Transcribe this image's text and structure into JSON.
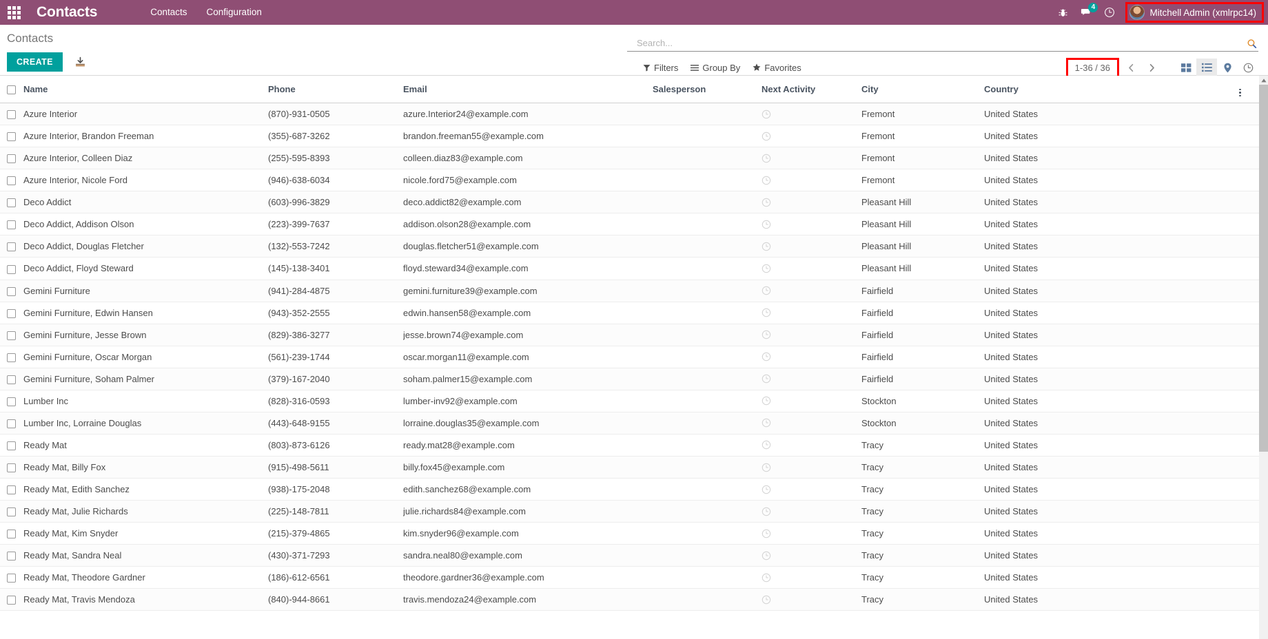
{
  "navbar": {
    "apps_menu_label": "Apps",
    "brand": "Contacts",
    "menus": [
      {
        "label": "Contacts"
      },
      {
        "label": "Configuration"
      }
    ],
    "icons": {
      "debug": "bug-icon",
      "messages": "messages-icon",
      "activities": "activities-clock-icon"
    },
    "message_count": "4",
    "user_name": "Mitchell Admin (xmlrpc14)",
    "highlight_color": "#ff0000",
    "background_color": "#8f4e74"
  },
  "control_panel": {
    "breadcrumb": "Contacts",
    "create_label": "CREATE",
    "create_color": "#00a09d",
    "import_icon": "import-icon",
    "search": {
      "placeholder": "Search...",
      "value": "",
      "icon": "search-icon"
    },
    "filters": [
      {
        "label": "Filters",
        "icon": "filter-icon"
      },
      {
        "label": "Group By",
        "icon": "group-by-icon"
      },
      {
        "label": "Favorites",
        "icon": "star-icon"
      }
    ],
    "pager": {
      "count": "1-36 / 36",
      "previous_icon": "chevron-left-icon",
      "next_icon": "chevron-right-icon",
      "highlight_color": "#ff0000"
    },
    "views": [
      {
        "name": "kanban",
        "icon": "kanban-icon",
        "active": false
      },
      {
        "name": "list",
        "icon": "list-icon",
        "active": true
      },
      {
        "name": "map",
        "icon": "map-pin-icon",
        "active": true
      },
      {
        "name": "activity",
        "icon": "activity-clock-icon",
        "active": false
      }
    ]
  },
  "table": {
    "columns": [
      "Name",
      "Phone",
      "Email",
      "Salesperson",
      "Next Activity",
      "City",
      "Country"
    ],
    "options_icon": "column-options-icon",
    "select_all_label": "Select all",
    "rows": [
      {
        "name": "Azure Interior",
        "phone": "(870)-931-0505",
        "email": "azure.Interior24@example.com",
        "salesperson": "",
        "activity": "",
        "city": "Fremont",
        "country": "United States"
      },
      {
        "name": "Azure Interior, Brandon Freeman",
        "phone": "(355)-687-3262",
        "email": "brandon.freeman55@example.com",
        "salesperson": "",
        "activity": "",
        "city": "Fremont",
        "country": "United States"
      },
      {
        "name": "Azure Interior, Colleen Diaz",
        "phone": "(255)-595-8393",
        "email": "colleen.diaz83@example.com",
        "salesperson": "",
        "activity": "",
        "city": "Fremont",
        "country": "United States"
      },
      {
        "name": "Azure Interior, Nicole Ford",
        "phone": "(946)-638-6034",
        "email": "nicole.ford75@example.com",
        "salesperson": "",
        "activity": "",
        "city": "Fremont",
        "country": "United States"
      },
      {
        "name": "Deco Addict",
        "phone": "(603)-996-3829",
        "email": "deco.addict82@example.com",
        "salesperson": "",
        "activity": "",
        "city": "Pleasant Hill",
        "country": "United States"
      },
      {
        "name": "Deco Addict, Addison Olson",
        "phone": "(223)-399-7637",
        "email": "addison.olson28@example.com",
        "salesperson": "",
        "activity": "",
        "city": "Pleasant Hill",
        "country": "United States"
      },
      {
        "name": "Deco Addict, Douglas Fletcher",
        "phone": "(132)-553-7242",
        "email": "douglas.fletcher51@example.com",
        "salesperson": "",
        "activity": "",
        "city": "Pleasant Hill",
        "country": "United States"
      },
      {
        "name": "Deco Addict, Floyd Steward",
        "phone": "(145)-138-3401",
        "email": "floyd.steward34@example.com",
        "salesperson": "",
        "activity": "",
        "city": "Pleasant Hill",
        "country": "United States"
      },
      {
        "name": "Gemini Furniture",
        "phone": "(941)-284-4875",
        "email": "gemini.furniture39@example.com",
        "salesperson": "",
        "activity": "",
        "city": "Fairfield",
        "country": "United States"
      },
      {
        "name": "Gemini Furniture, Edwin Hansen",
        "phone": "(943)-352-2555",
        "email": "edwin.hansen58@example.com",
        "salesperson": "",
        "activity": "",
        "city": "Fairfield",
        "country": "United States"
      },
      {
        "name": "Gemini Furniture, Jesse Brown",
        "phone": "(829)-386-3277",
        "email": "jesse.brown74@example.com",
        "salesperson": "",
        "activity": "",
        "city": "Fairfield",
        "country": "United States"
      },
      {
        "name": "Gemini Furniture, Oscar Morgan",
        "phone": "(561)-239-1744",
        "email": "oscar.morgan11@example.com",
        "salesperson": "",
        "activity": "",
        "city": "Fairfield",
        "country": "United States"
      },
      {
        "name": "Gemini Furniture, Soham Palmer",
        "phone": "(379)-167-2040",
        "email": "soham.palmer15@example.com",
        "salesperson": "",
        "activity": "",
        "city": "Fairfield",
        "country": "United States"
      },
      {
        "name": "Lumber Inc",
        "phone": "(828)-316-0593",
        "email": "lumber-inv92@example.com",
        "salesperson": "",
        "activity": "",
        "city": "Stockton",
        "country": "United States"
      },
      {
        "name": "Lumber Inc, Lorraine Douglas",
        "phone": "(443)-648-9155",
        "email": "lorraine.douglas35@example.com",
        "salesperson": "",
        "activity": "",
        "city": "Stockton",
        "country": "United States"
      },
      {
        "name": "Ready Mat",
        "phone": "(803)-873-6126",
        "email": "ready.mat28@example.com",
        "salesperson": "",
        "activity": "",
        "city": "Tracy",
        "country": "United States"
      },
      {
        "name": "Ready Mat, Billy Fox",
        "phone": "(915)-498-5611",
        "email": "billy.fox45@example.com",
        "salesperson": "",
        "activity": "",
        "city": "Tracy",
        "country": "United States"
      },
      {
        "name": "Ready Mat, Edith Sanchez",
        "phone": "(938)-175-2048",
        "email": "edith.sanchez68@example.com",
        "salesperson": "",
        "activity": "",
        "city": "Tracy",
        "country": "United States"
      },
      {
        "name": "Ready Mat, Julie Richards",
        "phone": "(225)-148-7811",
        "email": "julie.richards84@example.com",
        "salesperson": "",
        "activity": "",
        "city": "Tracy",
        "country": "United States"
      },
      {
        "name": "Ready Mat, Kim Snyder",
        "phone": "(215)-379-4865",
        "email": "kim.snyder96@example.com",
        "salesperson": "",
        "activity": "",
        "city": "Tracy",
        "country": "United States"
      },
      {
        "name": "Ready Mat, Sandra Neal",
        "phone": "(430)-371-7293",
        "email": "sandra.neal80@example.com",
        "salesperson": "",
        "activity": "",
        "city": "Tracy",
        "country": "United States"
      },
      {
        "name": "Ready Mat, Theodore Gardner",
        "phone": "(186)-612-6561",
        "email": "theodore.gardner36@example.com",
        "salesperson": "",
        "activity": "",
        "city": "Tracy",
        "country": "United States"
      },
      {
        "name": "Ready Mat, Travis Mendoza",
        "phone": "(840)-944-8661",
        "email": "travis.mendoza24@example.com",
        "salesperson": "",
        "activity": "",
        "city": "Tracy",
        "country": "United States"
      }
    ]
  }
}
